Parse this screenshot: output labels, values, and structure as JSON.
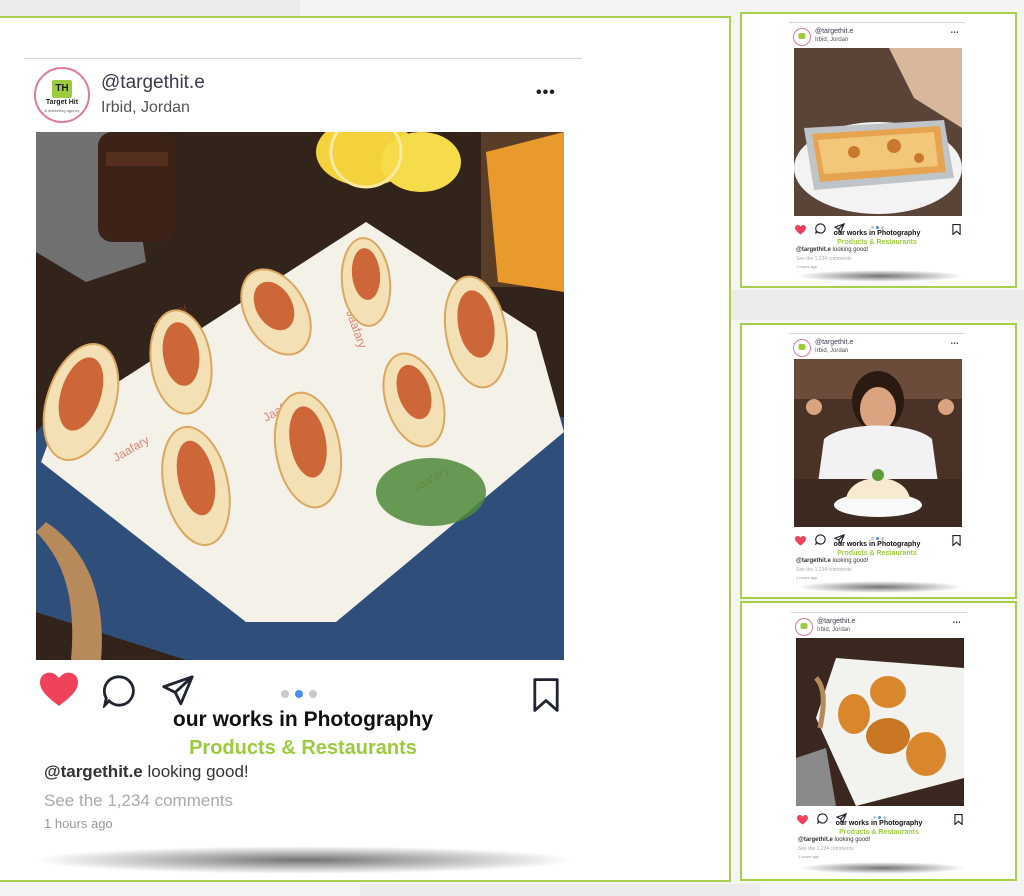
{
  "main_post": {
    "username": "@targethit.e",
    "location": "Irbid, Jordan",
    "menu": "•••",
    "logo_initials": "TH",
    "logo_brand": "Target Hit",
    "logo_tagline": "A marketing agency",
    "title": "our works in Photography",
    "subtitle": "Products & Restaurants",
    "caption_user": "@targethit.e",
    "caption_text": " looking good!",
    "comments": "See the 1,234 comments",
    "time": "1 hours ago"
  },
  "side_posts": [
    {
      "username": "@targethit.e",
      "location": "Irbid, Jordan",
      "menu": "•••",
      "title": "our works in Photography",
      "subtitle": "Products & Restaurants",
      "caption_user": "@targethit.e",
      "caption_text": " looking good!",
      "comments": "See the 1,234 comments",
      "time": "1 hours ago"
    },
    {
      "username": "@targethit.e",
      "location": "Irbid, Jordan",
      "menu": "•••",
      "title": "our works in Photography",
      "subtitle": "Products & Restaurants",
      "caption_user": "@targethit.e",
      "caption_text": " looking good!",
      "comments": "See the 1,234 comments",
      "time": "1 hours ago"
    },
    {
      "username": "@targethit.e",
      "location": "Irbid, Jordan",
      "menu": "•••",
      "title": "our works in Photography",
      "subtitle": "Products & Restaurants",
      "caption_user": "@targethit.e",
      "caption_text": " looking good!",
      "comments": "See the 1,234 comments",
      "time": "1 hours ago"
    }
  ],
  "colors": {
    "accent_green": "#a7d14a",
    "like_red": "#f0425b",
    "active_dot": "#4a8ff0"
  },
  "icons": [
    "heart-icon",
    "comment-icon",
    "share-icon",
    "bookmark-icon",
    "more-icon"
  ]
}
